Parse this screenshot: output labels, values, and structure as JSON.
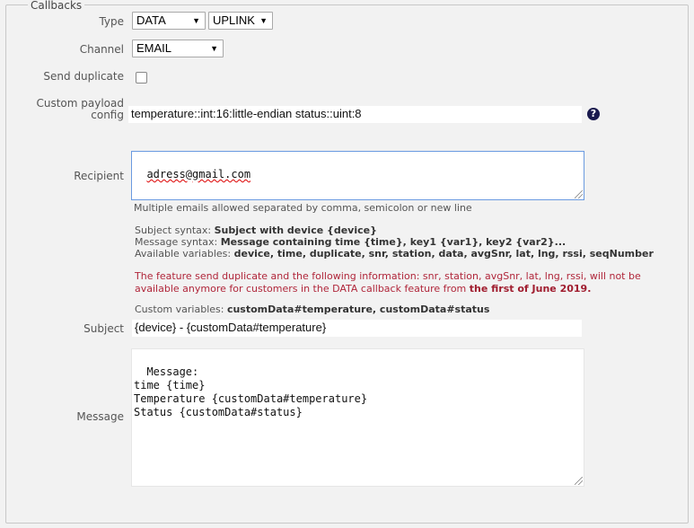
{
  "legend": "Callbacks",
  "type": {
    "label": "Type",
    "value": "DATA",
    "direction": "UPLINK"
  },
  "channel": {
    "label": "Channel",
    "value": "EMAIL"
  },
  "send_duplicate": {
    "label": "Send duplicate",
    "checked": false
  },
  "payload": {
    "label_line1": "Custom payload",
    "label_line2": "config",
    "value": "temperature::int:16:little-endian status::uint:8",
    "help_icon": "question-circle-icon"
  },
  "recipient": {
    "label": "Recipient",
    "value": "adress@gmail.com",
    "hint": "Multiple emails allowed separated by comma, semicolon or new line"
  },
  "syntax": {
    "subject_prefix": "Subject syntax:",
    "subject_value": "Subject with device {device}",
    "message_prefix": "Message syntax:",
    "message_value": "Message containing time {time}, key1 {var1}, key2 {var2}...",
    "variables_prefix": "Available variables:",
    "variables_value": "device, time, duplicate, snr, station, data, avgSnr, lat, lng, rssi, seqNumber"
  },
  "warning": {
    "line1": "The feature send duplicate and the following information: snr, station, avgSnr, lat, lng, rssi, will not be",
    "line2_prefix": "available anymore for customers in the DATA callback feature from",
    "line2_bold": "the first of June 2019."
  },
  "custom_vars": {
    "prefix": "Custom variables:",
    "value": "customData#temperature, customData#status"
  },
  "subject": {
    "label": "Subject",
    "value": "{device} -  {customData#temperature}"
  },
  "message": {
    "label": "Message",
    "value": "Message:\ntime {time}\nTemperature {customData#temperature}\nStatus {customData#status}"
  },
  "colors": {
    "warning": "#b0263a",
    "focus_border": "#6a9ae0",
    "help_icon": "#1a1a4e"
  }
}
